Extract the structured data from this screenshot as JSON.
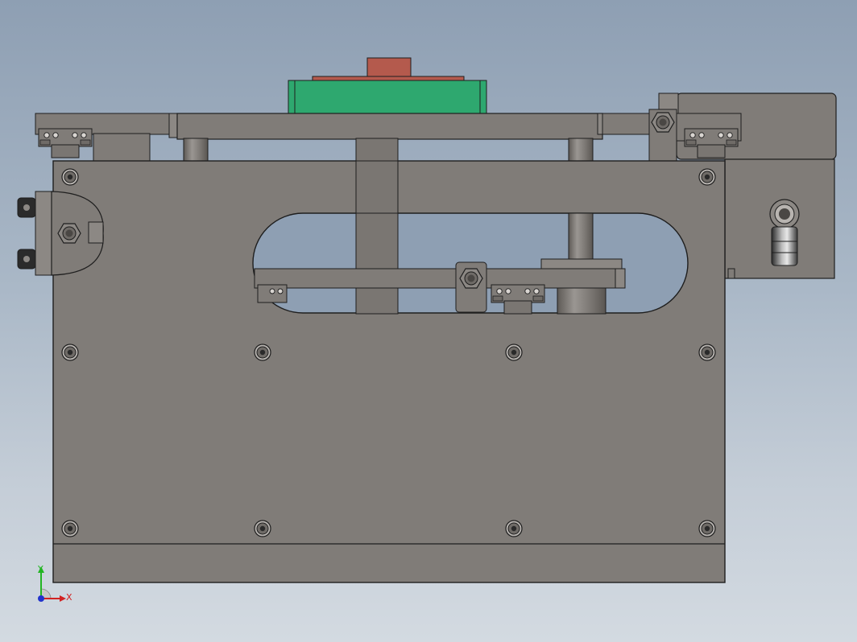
{
  "view": {
    "model": "cad-assembly-front-view",
    "background_gradient": [
      "#8e9fb3",
      "#aab8c7",
      "#d3dae1"
    ]
  },
  "colors": {
    "steel": "#807c78",
    "steel_dark": "#6f6b67",
    "steel_light": "#8c8884",
    "edge": "#1e1e1e",
    "green_part": "#2ea86f",
    "red_part": "#b45a4d",
    "axis_x": "#d22222",
    "axis_y": "#22b522",
    "axis_z": "#2233cc"
  },
  "triad": {
    "x_label": "X",
    "y_label": "Y",
    "x_icon": "x-axis-arrow-icon",
    "y_icon": "y-axis-arrow-icon",
    "z_icon": "z-axis-dot-icon"
  }
}
